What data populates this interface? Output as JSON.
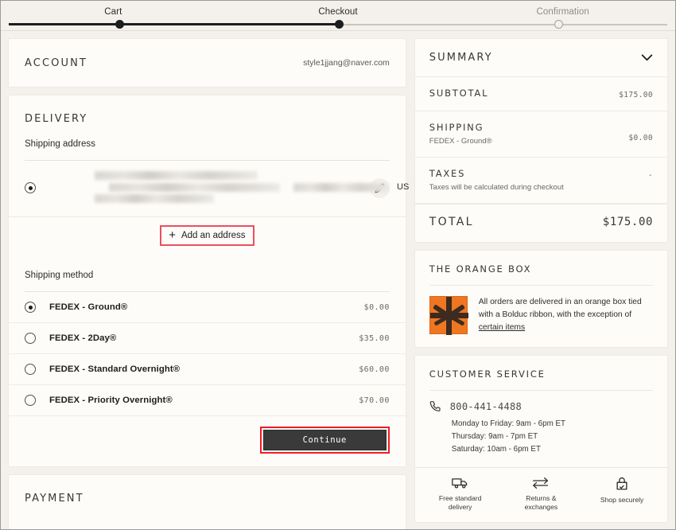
{
  "stepper": {
    "steps": [
      {
        "label": "Cart",
        "state": "done"
      },
      {
        "label": "Checkout",
        "state": "current"
      },
      {
        "label": "Confirmation",
        "state": "upcoming"
      }
    ]
  },
  "account": {
    "title": "Account",
    "email": "style1jjang@naver.com"
  },
  "delivery": {
    "title": "Delivery",
    "shipping_address_label": "Shipping address",
    "address": {
      "redacted": true,
      "country": "US"
    },
    "add_address_label": "Add an address",
    "add_address_icon": "plus-icon",
    "edit_icon": "pencil-icon",
    "shipping_method_label": "Shipping method",
    "methods": [
      {
        "name": "FEDEX - Ground®",
        "price": "$0.00",
        "selected": true
      },
      {
        "name": "FEDEX - 2Day®",
        "price": "$35.00",
        "selected": false
      },
      {
        "name": "FEDEX - Standard Overnight®",
        "price": "$60.00",
        "selected": false
      },
      {
        "name": "FEDEX - Priority Overnight®",
        "price": "$70.00",
        "selected": false
      }
    ],
    "continue_label": "Continue"
  },
  "payment": {
    "title": "Payment"
  },
  "summary": {
    "title": "Summary",
    "collapse_icon": "chevron-down-icon",
    "rows": [
      {
        "label": "Subtotal",
        "sub": "",
        "value": "$175.00"
      },
      {
        "label": "Shipping",
        "sub": "FEDEX - Ground®",
        "value": "$0.00"
      },
      {
        "label": "Taxes",
        "sub": "Taxes will be calculated during checkout",
        "value": "-"
      }
    ],
    "total_label": "Total",
    "total_value": "$175.00"
  },
  "orange_box": {
    "title": "The orange box",
    "image_icon": "orange-gift-box-image",
    "text_before": "All orders are delivered in an orange box tied with a Bolduc ribbon, with the exception of ",
    "link_text": "certain items"
  },
  "customer_service": {
    "title": "Customer Service",
    "phone_icon": "phone-icon",
    "phone": "800-441-4488",
    "hours": [
      "Monday to Friday: 9am - 6pm ET",
      "Thursday: 9am - 7pm ET",
      "Saturday: 10am - 6pm ET"
    ],
    "benefits": [
      {
        "icon": "truck-icon",
        "line1": "Free standard",
        "line2": "delivery"
      },
      {
        "icon": "exchange-arrows-icon",
        "line1": "Returns &",
        "line2": "exchanges"
      },
      {
        "icon": "lock-icon",
        "line1": "Shop securely",
        "line2": ""
      }
    ]
  },
  "colors": {
    "page_background": "#f4f1ec",
    "card_background": "#fdfcf9",
    "text": "#2b2b2b",
    "highlight_red": "#ee1c25",
    "addaddr_red": "#e8505f",
    "button_dark": "#3a3a3a",
    "orange": "#ef7721"
  }
}
